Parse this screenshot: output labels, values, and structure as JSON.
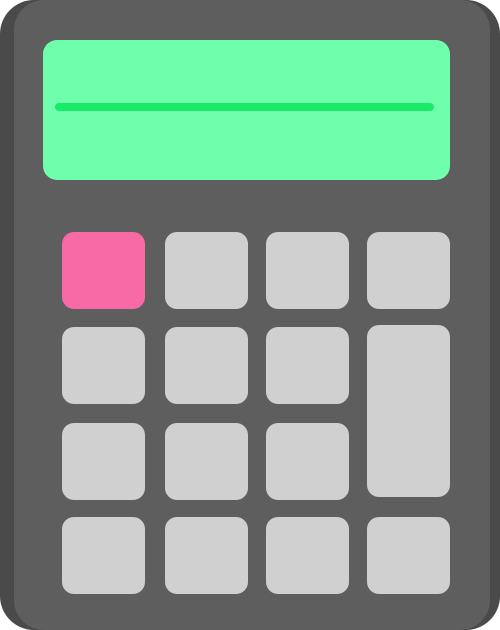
{
  "calculator": {
    "display": {
      "readout": ""
    },
    "keys": [
      {
        "row": 1,
        "col": 1,
        "type": "clear-key",
        "color": "#f76aa5"
      },
      {
        "row": 1,
        "col": 2,
        "type": "key",
        "color": "#d0d0d0"
      },
      {
        "row": 1,
        "col": 3,
        "type": "key",
        "color": "#d0d0d0"
      },
      {
        "row": 1,
        "col": 4,
        "type": "key",
        "color": "#d0d0d0"
      },
      {
        "row": 2,
        "col": 1,
        "type": "key",
        "color": "#d0d0d0"
      },
      {
        "row": 2,
        "col": 2,
        "type": "key",
        "color": "#d0d0d0"
      },
      {
        "row": 2,
        "col": 3,
        "type": "key",
        "color": "#d0d0d0"
      },
      {
        "row": 2,
        "col": 4,
        "type": "tall-key",
        "color": "#d0d0d0"
      },
      {
        "row": 3,
        "col": 1,
        "type": "key",
        "color": "#d0d0d0"
      },
      {
        "row": 3,
        "col": 2,
        "type": "key",
        "color": "#d0d0d0"
      },
      {
        "row": 3,
        "col": 3,
        "type": "key",
        "color": "#d0d0d0"
      },
      {
        "row": 4,
        "col": 1,
        "type": "key",
        "color": "#d0d0d0"
      },
      {
        "row": 4,
        "col": 2,
        "type": "key",
        "color": "#d0d0d0"
      },
      {
        "row": 4,
        "col": 3,
        "type": "key",
        "color": "#d0d0d0"
      },
      {
        "row": 4,
        "col": 4,
        "type": "key",
        "color": "#d0d0d0"
      }
    ],
    "colors": {
      "body": "#5e5e5e",
      "body_shadow": "#4a4a4a",
      "display": "#6fffac",
      "display_line": "#17ea67"
    }
  }
}
